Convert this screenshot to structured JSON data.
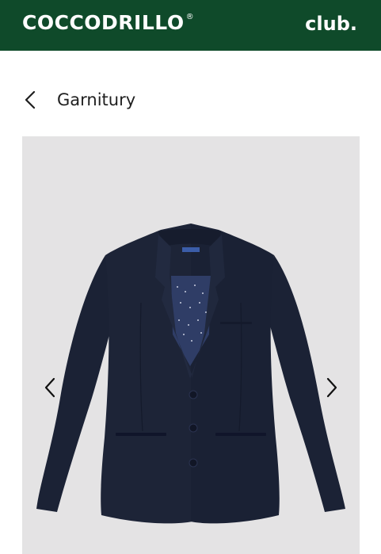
{
  "header": {
    "brand": "COCCODRILLO",
    "brand_mark": "®",
    "club_label": "club.",
    "background_color": "#0f4a2a"
  },
  "breadcrumb": {
    "back_icon": "chevron-left-icon",
    "label": "Garnitury"
  },
  "gallery": {
    "image_subject": "navy-blazer",
    "prev_icon": "chevron-left-icon",
    "next_icon": "chevron-right-icon",
    "background_color": "#e4e3e4"
  },
  "colors": {
    "blazer": "#1b2235",
    "lining": "#2f3d66"
  }
}
